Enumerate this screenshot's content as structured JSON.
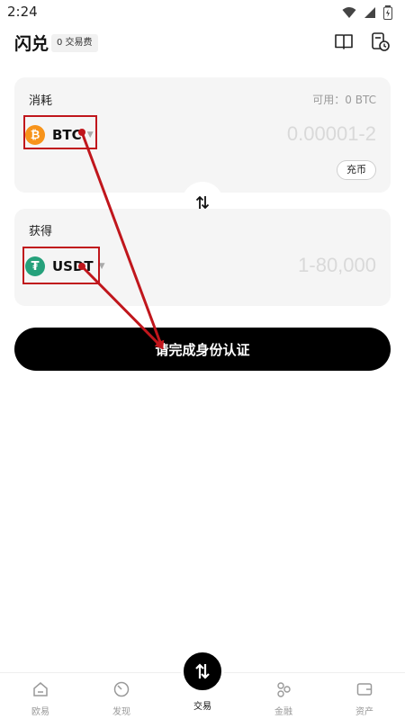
{
  "status_bar": {
    "time": "2:24"
  },
  "header": {
    "title": "闪兑",
    "fee_badge": "0 交易费"
  },
  "spend_card": {
    "label": "消耗",
    "available": "可用：0 BTC",
    "coin": "BTC",
    "coin_icon": "bitcoin-icon",
    "coin_color": "#f7931a",
    "amount_placeholder": "0.00001-2",
    "deposit_label": "充币"
  },
  "receive_card": {
    "label": "获得",
    "coin": "USDT",
    "coin_icon": "tether-icon",
    "coin_color": "#26a17b",
    "amount_placeholder": "1-80,000"
  },
  "primary_button": {
    "label": "请完成身份认证"
  },
  "tabbar": {
    "items": [
      {
        "label": "欧易",
        "icon": "home-icon"
      },
      {
        "label": "发现",
        "icon": "discover-icon"
      },
      {
        "label": "交易",
        "icon": "trade-icon"
      },
      {
        "label": "金融",
        "icon": "finance-icon"
      },
      {
        "label": "资产",
        "icon": "wallet-icon"
      }
    ]
  },
  "colors": {
    "annotation_red": "#c0161c",
    "accent_black": "#000000"
  }
}
